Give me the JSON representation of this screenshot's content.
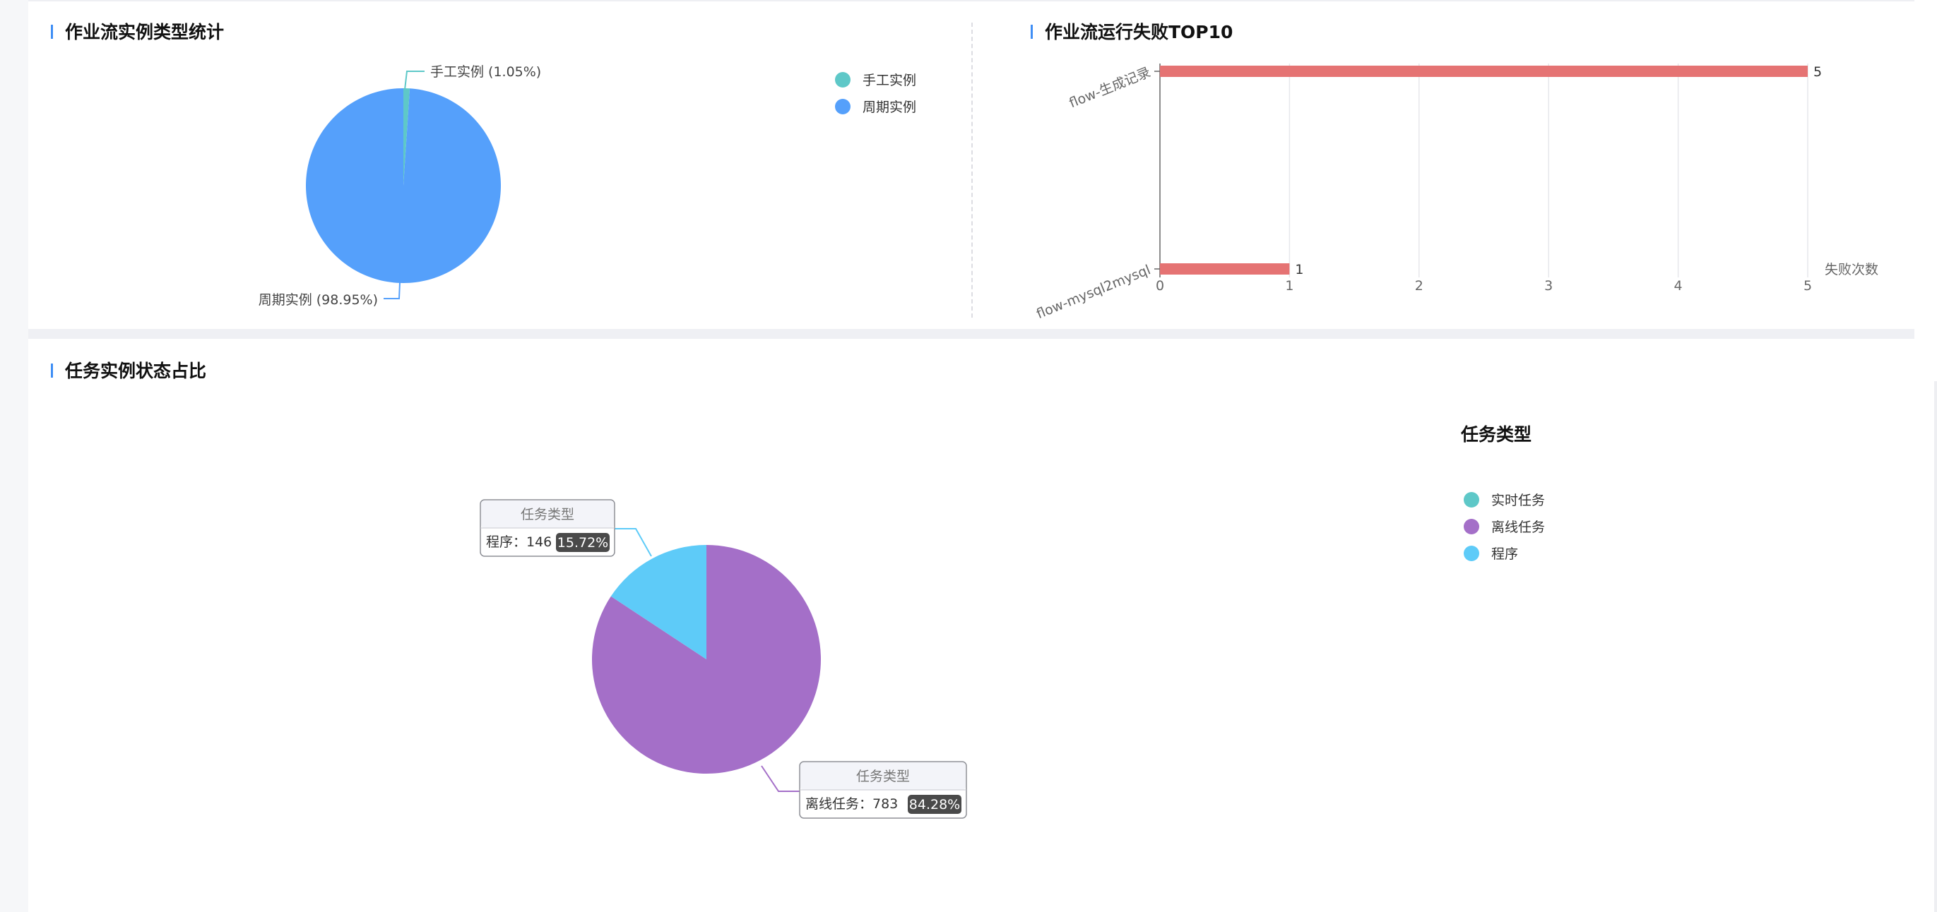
{
  "colors": {
    "accent": "#3f8ef5",
    "manual": "#5ec8c8",
    "periodic": "#55a0fb",
    "bar": "#e57373",
    "realtime": "#5ec8c8",
    "offline": "#a46fc8",
    "program": "#5ecbf8"
  },
  "panels": {
    "workflow_type": {
      "title": "作业流实例类型统计"
    },
    "failure_top": {
      "title": "作业流运行失败TOP10"
    },
    "task_status": {
      "title": "任务实例状态占比"
    }
  },
  "chart_data": [
    {
      "type": "pie",
      "slices": [
        {
          "name": "手工实例",
          "value": 1.05,
          "label": "手工实例 (1.05%)",
          "color": "#5ec8c8"
        },
        {
          "name": "周期实例",
          "value": 98.95,
          "label": "周期实例 (98.95%)",
          "color": "#55a0fb"
        }
      ],
      "legend": [
        "手工实例",
        "周期实例"
      ],
      "legend_position": "top-right"
    },
    {
      "type": "bar",
      "orientation": "horizontal",
      "categories": [
        "flow-生成记录",
        "flow-mysql2mysql"
      ],
      "values": [
        5,
        1
      ],
      "xlabel": "失败次数",
      "xlim": [
        0,
        5
      ],
      "xticks": [
        0,
        1,
        2,
        3,
        4,
        5
      ],
      "grid": true,
      "color": "#e57373"
    },
    {
      "type": "pie",
      "start_angle": 90,
      "slices": [
        {
          "name": "离线任务",
          "value": 783,
          "percent": "84.28%",
          "color": "#a46fc8"
        },
        {
          "name": "程序",
          "value": 146,
          "percent": "15.72%",
          "color": "#5ecbf8"
        }
      ],
      "tooltip_title": "任务类型",
      "legend_title": "任务类型",
      "legend": [
        {
          "name": "实时任务",
          "color": "#5ec8c8"
        },
        {
          "name": "离线任务",
          "color": "#a46fc8"
        },
        {
          "name": "程序",
          "color": "#5ecbf8"
        }
      ],
      "legend_position": "right"
    }
  ]
}
